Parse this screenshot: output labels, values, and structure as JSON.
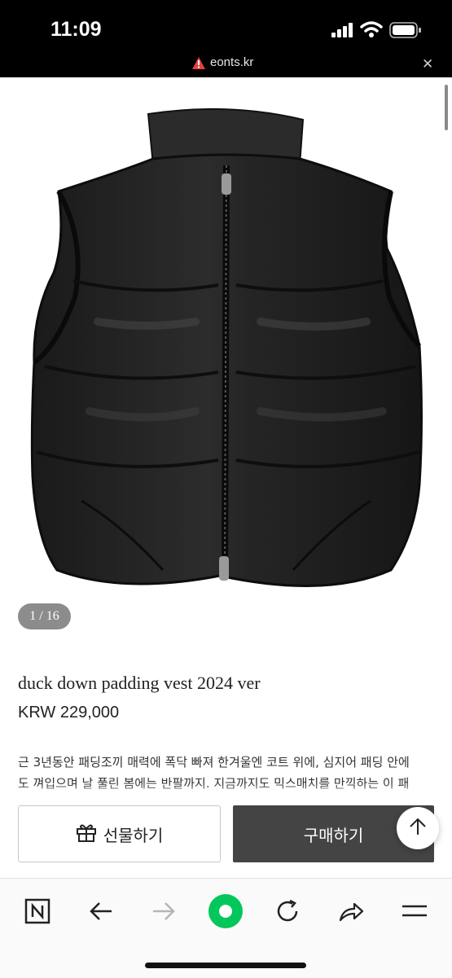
{
  "status": {
    "time": "11:09"
  },
  "browser": {
    "url": "eonts.kr"
  },
  "product": {
    "image_alt": "black duck down padding vest",
    "image_counter": "1 / 16",
    "title": "duck down padding vest 2024 ver",
    "price": "KRW 229,000",
    "description_lines": [
      "근 3년동안 패딩조끼 매력에 폭닥 빠져 한겨울엔 코트 위에, 심지어 패딩 안에",
      "도 껴입으며 날 풀린 봄에는 반팔까지. 지금까지도 믹스매치를 만끽하는 이 패"
    ]
  },
  "actions": {
    "gift_label": "선물하기",
    "buy_label": "구매하기"
  },
  "icons": {
    "status": [
      "signal-icon",
      "wifi-icon",
      "battery-icon"
    ],
    "toolbar": [
      "naver-n-icon",
      "back-arrow-icon",
      "forward-arrow-icon",
      "green-home-icon",
      "refresh-icon",
      "share-icon",
      "menu-icon"
    ]
  },
  "colors": {
    "buy_button": "#444444",
    "green_button": "#03c75a",
    "warning": "#e0443a"
  }
}
